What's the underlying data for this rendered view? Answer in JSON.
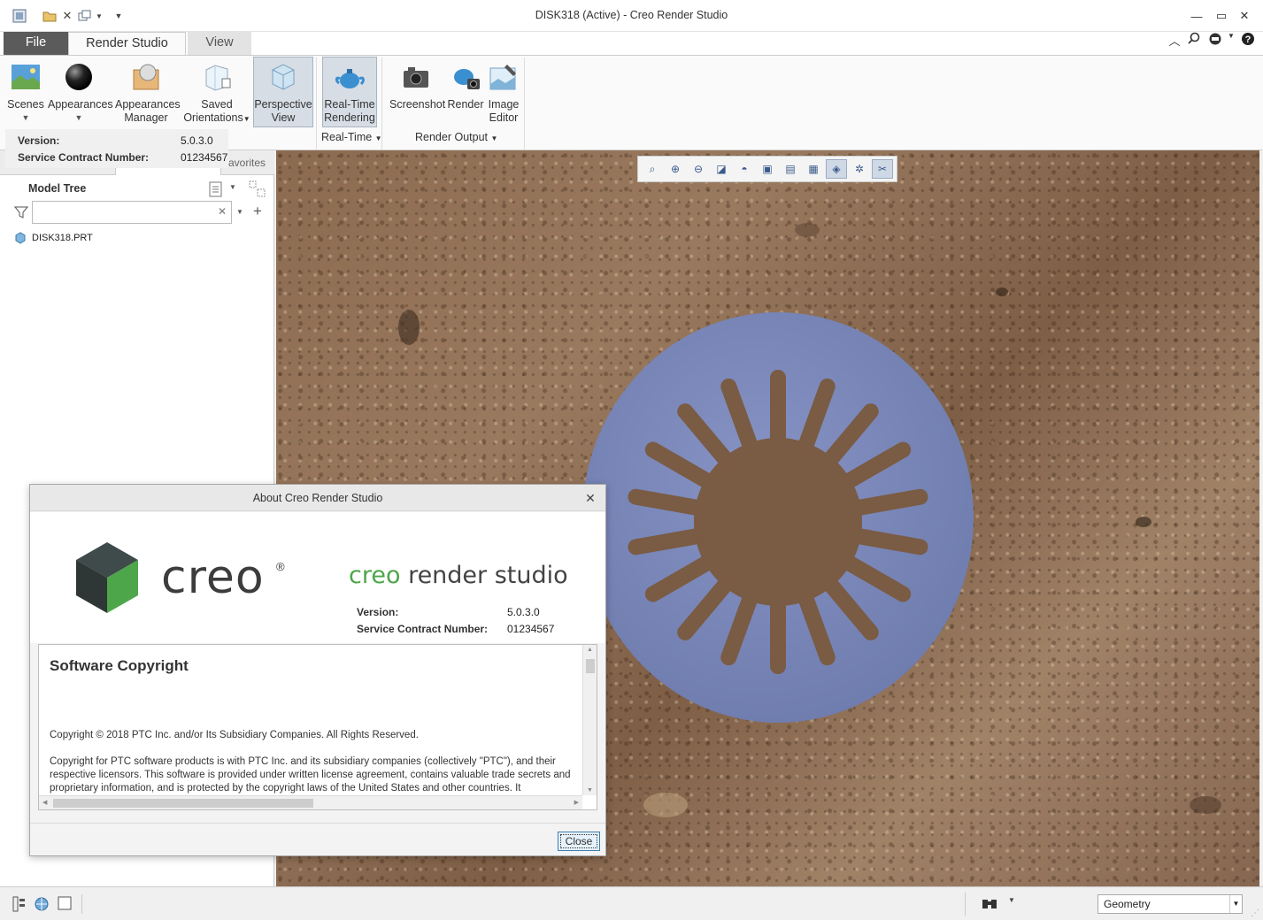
{
  "window": {
    "title": "DISK318 (Active) - Creo Render Studio"
  },
  "ribbon_tabs": [
    "File",
    "Render Studio",
    "View"
  ],
  "ribbon": {
    "scenes": "Scenes",
    "appearances": "Appearances",
    "appearances_manager_1": "Appearances",
    "appearances_manager_2": "Manager",
    "saved_orient_1": "Saved",
    "saved_orient_2": "Orientations",
    "perspective_1": "Perspective",
    "perspective_2": "View",
    "realtime_1": "Real-Time",
    "realtime_2": "Rendering",
    "screenshot": "Screenshot",
    "render": "Render",
    "image_editor_1": "Image",
    "image_editor_2": "Editor",
    "group_realtime": "Real-Time",
    "group_render_output": "Render Output"
  },
  "version_tip": {
    "version_label": "Version:",
    "version_value": "5.0.3.0",
    "contract_label": "Service Contract Number:",
    "contract_value": "01234567"
  },
  "left_panel": {
    "favorites_tab": "avorites",
    "model_tree_title": "Model Tree",
    "search_value": "",
    "items": [
      "DISK318.PRT"
    ]
  },
  "about_dialog": {
    "title": "About Creo Render Studio",
    "brand": "creo",
    "brand_reg": "®",
    "product_prefix": "creo",
    "product_name": " render studio",
    "version_label": "Version:",
    "version_value": "5.0.3.0",
    "contract_label": "Service Contract Number:",
    "contract_value": "01234567",
    "copyright_title": "Software Copyright",
    "copyright_line": "Copyright © 2018 PTC Inc. and/or Its Subsidiary Companies. All Rights Reserved.",
    "copyright_body": "Copyright for PTC software products is with PTC Inc. and its subsidiary companies (collectively \"PTC\"), and their respective licensors. This software is provided under written license agreement, contains valuable trade secrets and proprietary information, and is protected by the copyright laws of the United States and other countries. It",
    "close_label": "Close"
  },
  "status_bar": {
    "filter_value": "Geometry"
  },
  "colors": {
    "file_tab": "#5b5b5b",
    "disk": "#7c89b8",
    "creo_green": "#4ea64a",
    "soil": "#8c6a4f"
  }
}
